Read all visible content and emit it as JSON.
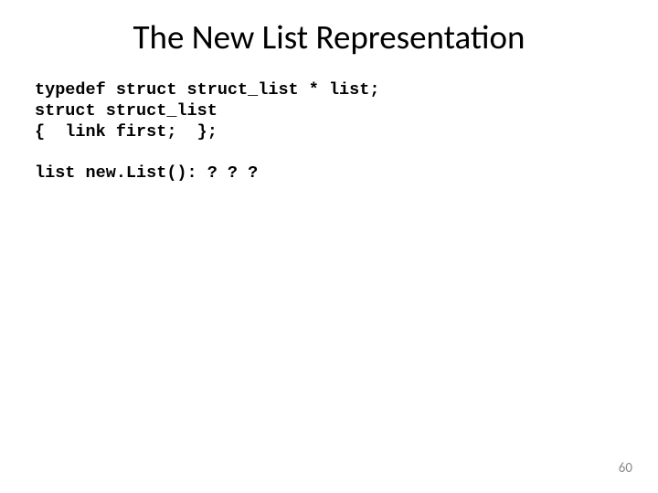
{
  "title": "The New List Representation",
  "code": {
    "line1": "typedef struct struct_list * list;",
    "line2": "struct struct_list",
    "line3": "{  link first;  };",
    "line4": "list new.List(): ? ? ?"
  },
  "page_number": "60"
}
